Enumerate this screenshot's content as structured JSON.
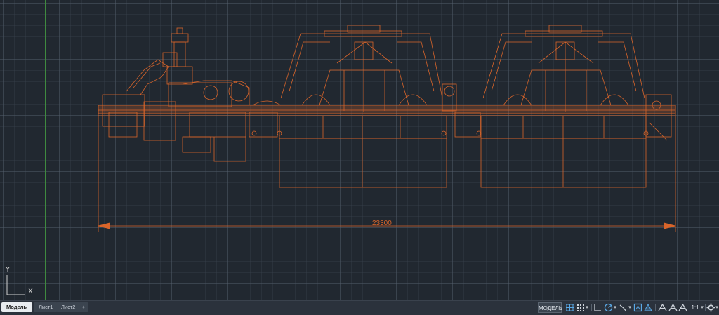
{
  "canvas": {
    "dimension_text": "23300",
    "ucs": {
      "y_label": "Y",
      "x_label": "X"
    },
    "colors": {
      "background": "#212830",
      "drawing": "#d9652a",
      "ucs_axis": "#3f8a3f"
    }
  },
  "layout_tabs": [
    {
      "label": "Модель",
      "active": true
    },
    {
      "label": "Лист1",
      "active": false
    },
    {
      "label": "Лист2",
      "active": false
    },
    {
      "label": "+",
      "active": false
    }
  ],
  "statusbar": {
    "model_label": "МОДЕЛЬ",
    "scale_label": "1:1",
    "icons": [
      "grid-icon",
      "snap-icon",
      "ortho-icon",
      "polar-icon",
      "isodraft-icon",
      "osnap-icon",
      "annotation-icon",
      "workspace-icon",
      "gear-icon"
    ]
  }
}
